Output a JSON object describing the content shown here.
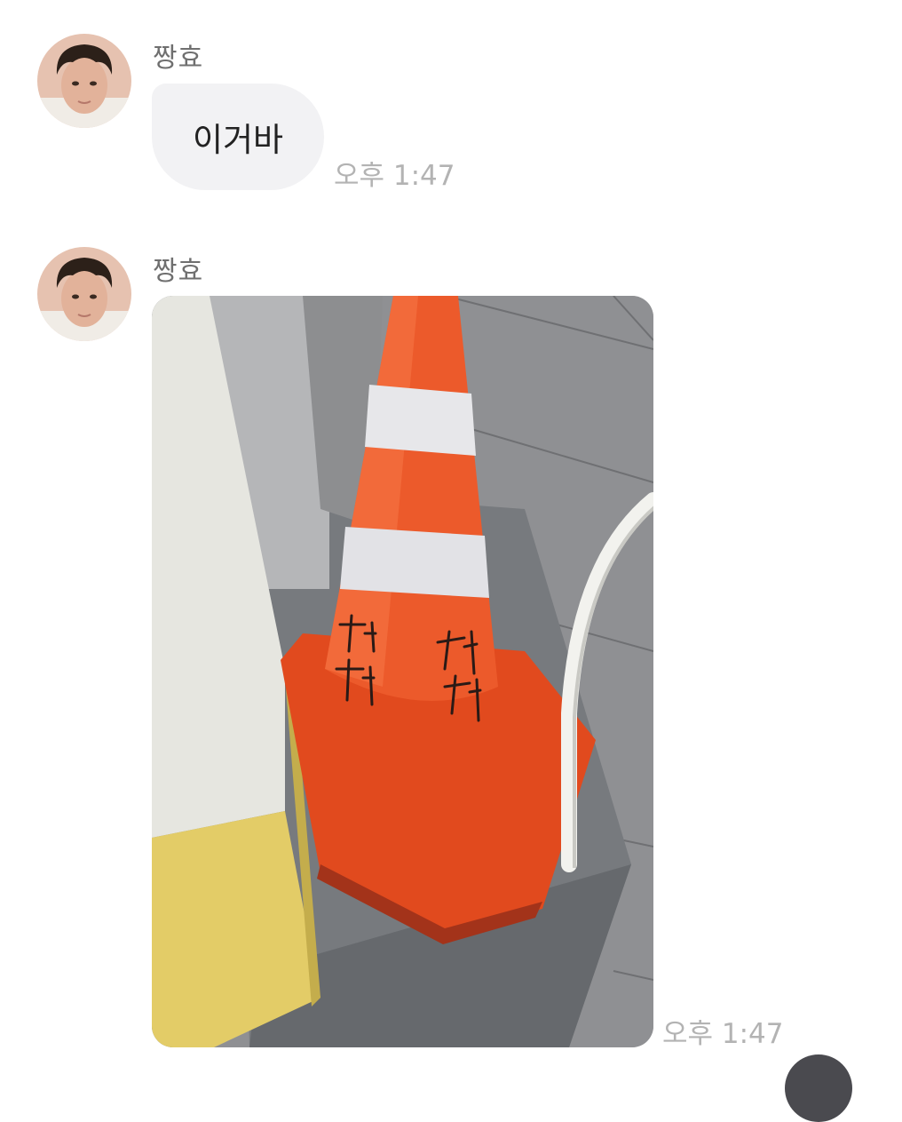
{
  "messages": [
    {
      "sender": "짱효",
      "text": "이거바",
      "time": "오후 1:47"
    },
    {
      "sender": "짱효",
      "photo": {
        "content": "orange traffic cone on pavement",
        "written_text": [
          "창현",
          "창현"
        ]
      },
      "time": "오후 1:47"
    }
  ],
  "colors": {
    "bubble": "#f2f2f4",
    "time": "#b3b3b3",
    "sender": "#6f6f6f",
    "cone": "#e8471c"
  }
}
